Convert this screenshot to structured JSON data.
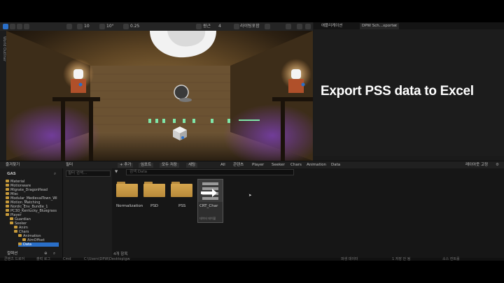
{
  "toolbar": {
    "mode_label": "선택 모드",
    "perspective": "원근",
    "lit": "라이팅포함",
    "grid_snap": "10",
    "rotation_snap": "10°",
    "scale_snap": "0.25",
    "camera_speed": "4"
  },
  "left_strip": "World Outliner",
  "right_panel": {
    "tabs": [
      "애플리케이션",
      "DPW Sch...xporter"
    ],
    "overlay_text": "Export PSS data to Excel"
  },
  "content_browser": {
    "add_label": "+ 추가",
    "import_label": "임포트",
    "save_all_label": "모두 저장",
    "settings_label": "세팅",
    "breadcrumb": [
      "All",
      "콘텐츠",
      "Player",
      "Seeker",
      "Chars",
      "Animation",
      "Data"
    ],
    "lock_label": "레이아웃 고정",
    "search_placeholder": "검색 Data",
    "favorites_label": "즐겨찾기",
    "project_label": "GAS",
    "filter_label": "필터",
    "filter_search_placeholder": "필터 검색...",
    "collections_label": "컬렉션",
    "item_count": "4개 항목",
    "tree": [
      "Material",
      "Motionware",
      "Migrate_DragonHead",
      "Misc",
      "Modular_MedievalTown_WI",
      "Motion_Matching",
      "Nordic_Env_Bundle_1",
      "PC3D_Kentucky_Bluegrass",
      "Player",
      "Guardian",
      "Seeker",
      "Anim",
      "Chars",
      "Animation",
      "AimOffset",
      "Data"
    ],
    "assets": [
      {
        "label": "Normalization",
        "type": "folder"
      },
      {
        "label": "PSD",
        "type": "folder"
      },
      {
        "label": "PSS",
        "type": "folder"
      },
      {
        "label": "CRT_Char",
        "sublabel": "데이터 테이블",
        "type": "datatable"
      }
    ]
  },
  "status_bar": {
    "drawer": "콘텐츠 드로어",
    "output": "출력 로그",
    "cmd": "Cmd",
    "console_placeholder": "콘솔 커맨드 입력",
    "path": "C:\\Users\\DPW\\Desktop\\gw",
    "derived": "파생 데이터",
    "unsaved": "1 저장 안 됨",
    "source_control": "소스 컨트롤"
  },
  "colors": {
    "accent_blue": "#2a6fc8",
    "folder": "#c79a3a",
    "overlay_bg": "#1c1c1c"
  }
}
